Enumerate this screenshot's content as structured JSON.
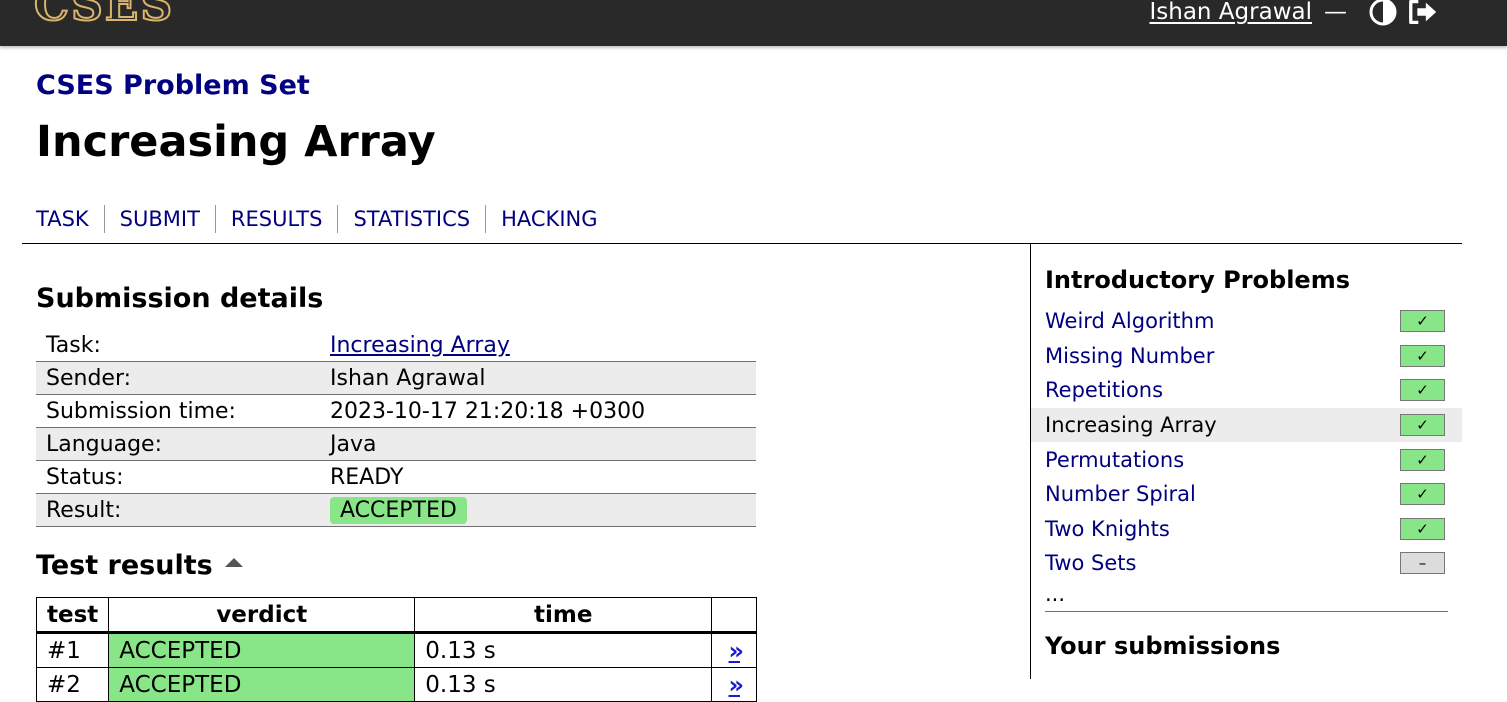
{
  "header": {
    "logo_text": "CSES",
    "user_name": "Ishan Agrawal",
    "separator": "—",
    "icons": [
      "theme-toggle-icon",
      "logout-icon"
    ]
  },
  "breadcrumb": "CSES Problem Set",
  "page_title": "Increasing Array",
  "tabs": [
    {
      "label": "TASK"
    },
    {
      "label": "SUBMIT"
    },
    {
      "label": "RESULTS"
    },
    {
      "label": "STATISTICS"
    },
    {
      "label": "HACKING"
    }
  ],
  "submission": {
    "heading": "Submission details",
    "rows": [
      {
        "key": "Task:",
        "value": "Increasing Array"
      },
      {
        "key": "Sender:",
        "value": "Ishan Agrawal"
      },
      {
        "key": "Submission time:",
        "value": "2023-10-17 21:20:18 +0300"
      },
      {
        "key": "Language:",
        "value": "Java"
      },
      {
        "key": "Status:",
        "value": "READY"
      },
      {
        "key": "Result:",
        "value": "ACCEPTED"
      }
    ]
  },
  "tests": {
    "heading": "Test results",
    "columns": [
      "test",
      "verdict",
      "time",
      ""
    ],
    "rows": [
      {
        "test": "#1",
        "verdict": "ACCEPTED",
        "time": "0.13 s",
        "link": "»"
      },
      {
        "test": "#2",
        "verdict": "ACCEPTED",
        "time": "0.13 s",
        "link": "»"
      }
    ]
  },
  "sidebar": {
    "heading": "Introductory Problems",
    "problems": [
      {
        "name": "Weird Algorithm",
        "status": "✓"
      },
      {
        "name": "Missing Number",
        "status": "✓"
      },
      {
        "name": "Repetitions",
        "status": "✓"
      },
      {
        "name": "Increasing Array",
        "status": "✓"
      },
      {
        "name": "Permutations",
        "status": "✓"
      },
      {
        "name": "Number Spiral",
        "status": "✓"
      },
      {
        "name": "Two Knights",
        "status": "✓"
      },
      {
        "name": "Two Sets",
        "status": "–"
      }
    ],
    "more": "...",
    "submissions_heading": "Your submissions"
  },
  "colors": {
    "topbar": "#292929",
    "link": "#000080",
    "accepted": "#88e588",
    "row_alt": "#ececec",
    "logo_gold": "#d9b46a"
  }
}
